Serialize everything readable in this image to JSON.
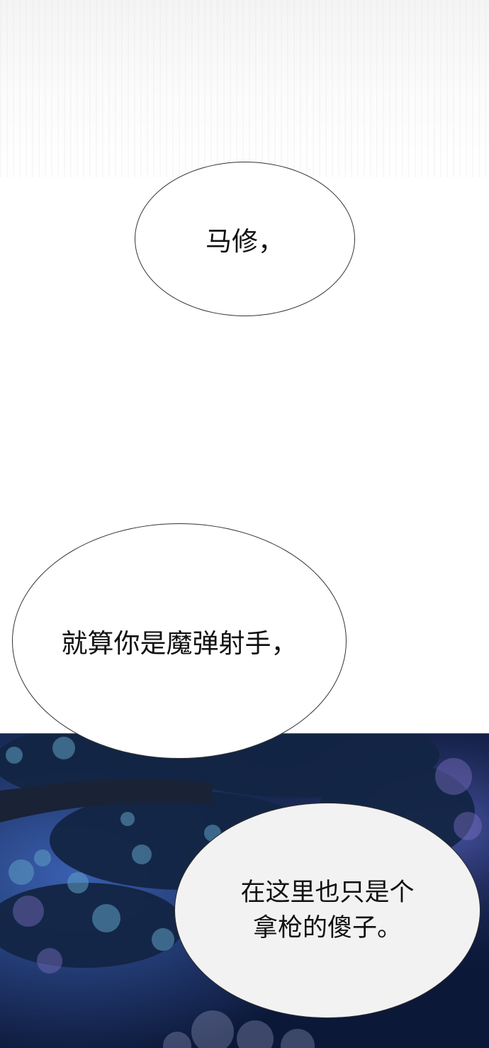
{
  "bubbles": [
    {
      "text": "马修，"
    },
    {
      "text": "就算你是魔弹射手，"
    },
    {
      "lines": [
        "在这里也只是个",
        "拿枪的傻子。"
      ]
    }
  ]
}
